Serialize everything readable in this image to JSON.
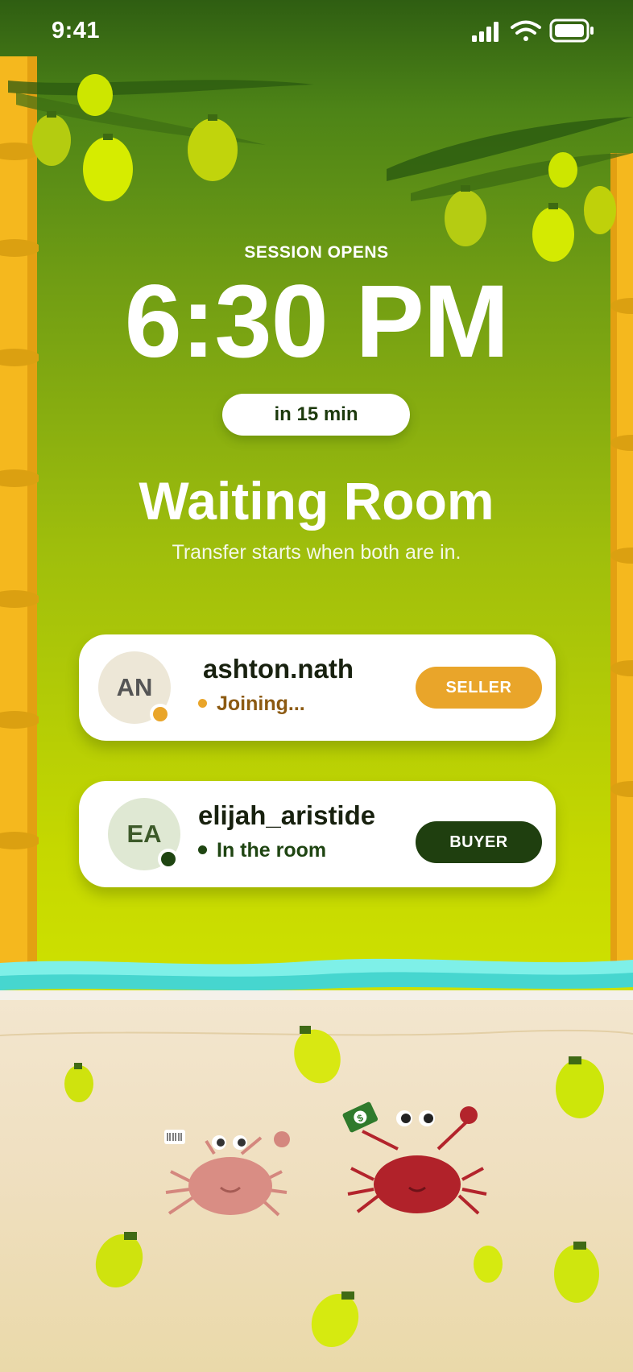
{
  "status_bar": {
    "time": "9:41"
  },
  "session": {
    "label": "SESSION OPENS",
    "time": "6:30 PM",
    "eta": "in 15 min"
  },
  "room": {
    "title": "Waiting Room",
    "subtitle": "Transfer starts when both are in."
  },
  "participants": [
    {
      "initials": "AN",
      "username": "ashton.nath",
      "status": "Joining...",
      "role": "SELLER",
      "status_color": "#e8a020",
      "role_color": "#e9a52a"
    },
    {
      "initials": "EA",
      "username": "elijah_aristide",
      "status": "In the room",
      "role": "BUYER",
      "status_color": "#1f4512",
      "role_color": "#1f3f0f"
    }
  ],
  "colors": {
    "accent_green": "#1f3f0f",
    "accent_orange": "#e9a52a",
    "bamboo": "#f5b81e",
    "sand": "#efdfbf"
  },
  "icons": [
    "signal-icon",
    "wifi-icon",
    "battery-icon",
    "pineapple-icon",
    "crab-icon",
    "barcode-icon",
    "money-icon"
  ]
}
